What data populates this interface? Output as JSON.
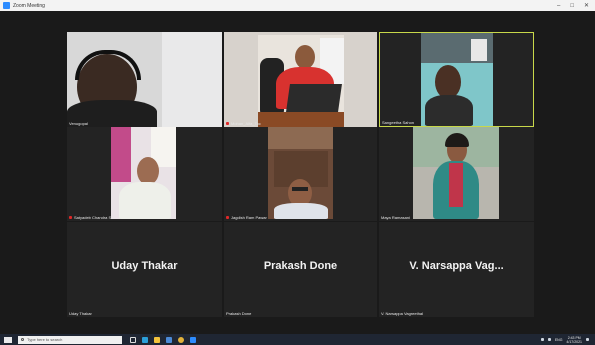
{
  "window": {
    "title": "Zoom Meeting",
    "minimize_icon": "minimize-icon",
    "maximize_icon": "maximize-icon",
    "close_icon": "close-icon"
  },
  "participants": [
    {
      "name": "Venugopal",
      "muted": false,
      "active": false,
      "video": true
    },
    {
      "name": "Mohan_Alfa_Toc",
      "muted": true,
      "active": false,
      "video": true
    },
    {
      "name": "Sangeetha Sahon",
      "muted": false,
      "active": true,
      "video": true
    },
    {
      "name": "Satyadeb Chandra Sa",
      "muted": true,
      "active": false,
      "video": true
    },
    {
      "name": "Jagdish Ram Pawar",
      "muted": true,
      "active": false,
      "video": true
    },
    {
      "name": "Maya Ramasani",
      "muted": false,
      "active": false,
      "video": true
    },
    {
      "name": "Uday Thakar",
      "display": "Uday Thakar",
      "muted": false,
      "active": false,
      "video": false
    },
    {
      "name": "Prakash Done",
      "display": "Prakash Done",
      "muted": false,
      "active": false,
      "video": false
    },
    {
      "name": "V. Narsappa Vagreethal",
      "display": "V. Narsappa Vag...",
      "muted": false,
      "active": false,
      "video": false
    }
  ],
  "taskbar": {
    "search_placeholder": "Type here to search",
    "time": "2:43 PM",
    "date": "4/17/2021",
    "language": "ENG"
  },
  "colors": {
    "meeting_bg": "#1a1a1a",
    "tile_bg": "#232323",
    "active_speaker": "#c8d84a",
    "muted_mic": "#e02828",
    "taskbar": "#1f2633"
  }
}
